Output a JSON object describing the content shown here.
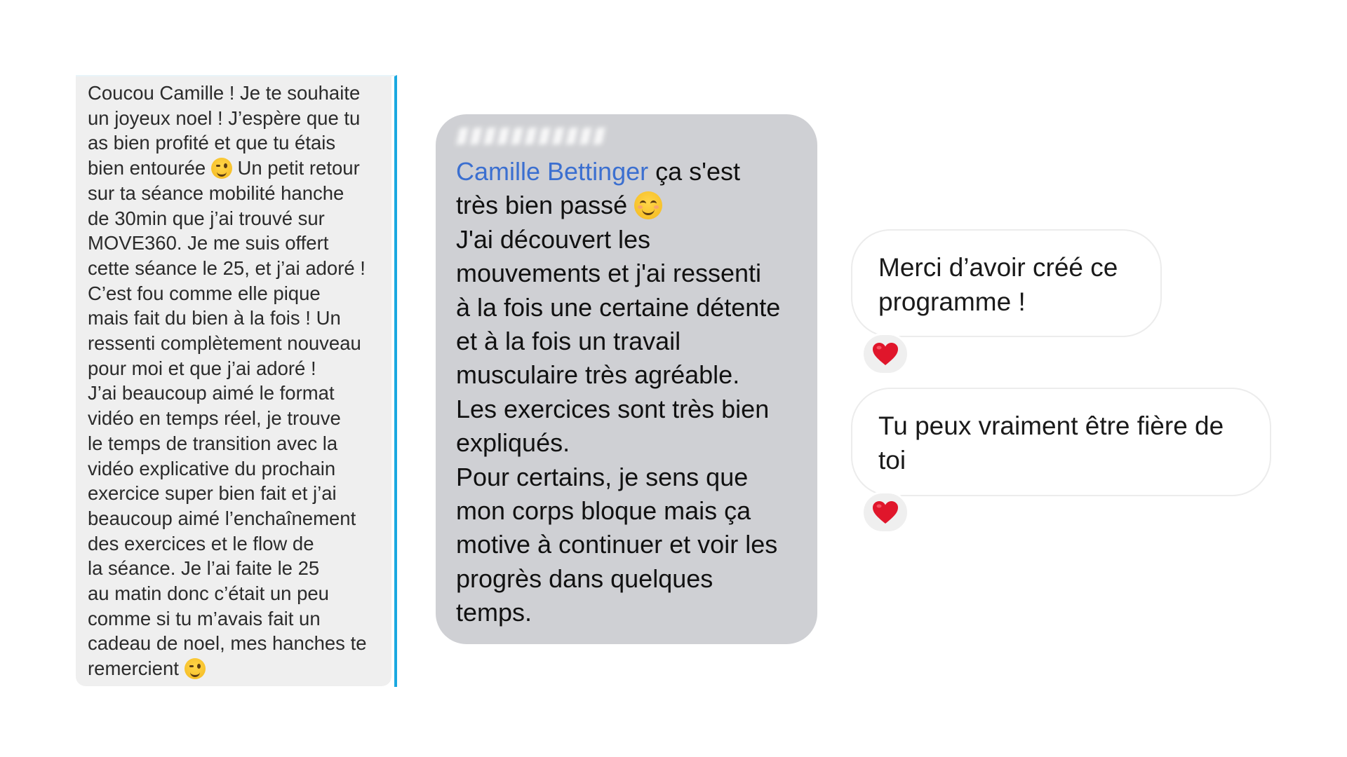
{
  "screenshot_left": {
    "lines": [
      "Coucou Camille ! Je te souhaite",
      "un joyeux noel ! J’espère que tu",
      "as bien profité et que tu étais",
      "bien entourée",
      " Un petit retour",
      "sur ta séance mobilité hanche",
      "de 30min que j’ai trouvé sur",
      "MOVE360. Je me suis offert",
      "cette séance le 25, et j’ai adoré !",
      "C’est fou comme elle pique",
      "mais fait du bien à la fois ! Un",
      "ressenti complètement nouveau",
      "pour moi et que j’ai adoré !",
      "J’ai beaucoup aimé le format",
      "vidéo en temps réel, je trouve",
      "le temps de transition avec la",
      "vidéo explicative du prochain",
      "exercice super bien fait et j’ai",
      "beaucoup aimé l’enchaînement",
      "des exercices et le flow de",
      "la séance. Je l’ai faite le 25",
      "au matin donc c’était un peu",
      "comme si tu m’avais fait un",
      "cadeau de noel, mes hanches te",
      "remercient"
    ],
    "emoji": "winking-face-emoji",
    "accent_color": "#1aa8e0",
    "bubble_color": "#efefef"
  },
  "screenshot_middle": {
    "mention": "Camille Bettinger",
    "line1_rest": " ça s'est",
    "line2": "très bien passé",
    "lines": [
      "J'ai découvert les",
      "mouvements et j'ai ressenti",
      "à la fois une certaine détente",
      "et à la fois un travail",
      "musculaire très agréable.",
      "Les exercices sont très bien",
      "expliqués.",
      "Pour certains, je sens que",
      "mon corps bloque mais ça",
      "motive à continuer et voir les",
      "progrès dans quelques",
      "temps."
    ],
    "emoji": "smiling-face-emoji",
    "mention_color": "#3b6fd0",
    "bubble_color": "#cfd0d4"
  },
  "screenshot_right": {
    "messages": [
      {
        "text_line1": "Merci d’avoir créé ce",
        "text_line2": "programme !",
        "reaction": "red-heart"
      },
      {
        "text_line1": "Tu peux vraiment être fière de",
        "text_line2": "toi",
        "reaction": "red-heart"
      }
    ],
    "reaction_color": "#e0162b"
  }
}
